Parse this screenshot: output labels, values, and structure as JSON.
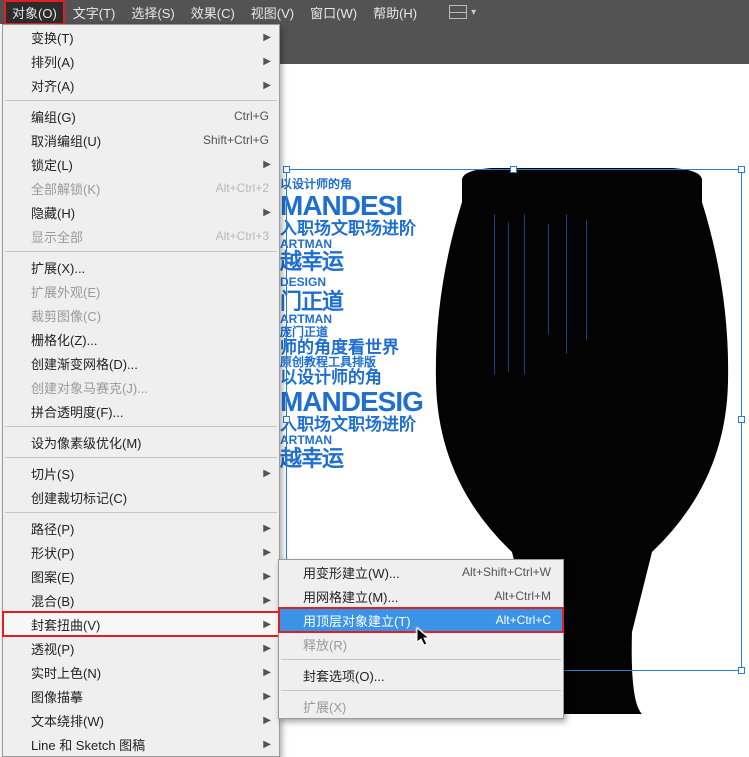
{
  "menubar": {
    "items": [
      {
        "label": "对象(O)",
        "active": true
      },
      {
        "label": "文字(T)"
      },
      {
        "label": "选择(S)"
      },
      {
        "label": "效果(C)"
      },
      {
        "label": "视图(V)"
      },
      {
        "label": "窗口(W)"
      },
      {
        "label": "帮助(H)"
      }
    ]
  },
  "menu": {
    "items": [
      {
        "label": "变换(T)",
        "arrow": true
      },
      {
        "label": "排列(A)",
        "arrow": true
      },
      {
        "label": "对齐(A)",
        "arrow": true
      },
      {
        "sep": true
      },
      {
        "label": "编组(G)",
        "sc": "Ctrl+G"
      },
      {
        "label": "取消编组(U)",
        "sc": "Shift+Ctrl+G"
      },
      {
        "label": "锁定(L)",
        "arrow": true
      },
      {
        "label": "全部解锁(K)",
        "sc": "Alt+Ctrl+2",
        "disabled": true
      },
      {
        "label": "隐藏(H)",
        "arrow": true
      },
      {
        "label": "显示全部",
        "sc": "Alt+Ctrl+3",
        "disabled": true
      },
      {
        "sep": true
      },
      {
        "label": "扩展(X)..."
      },
      {
        "label": "扩展外观(E)",
        "disabled": true
      },
      {
        "label": "裁剪图像(C)",
        "disabled": true
      },
      {
        "label": "栅格化(Z)..."
      },
      {
        "label": "创建渐变网格(D)..."
      },
      {
        "label": "创建对象马赛克(J)...",
        "disabled": true
      },
      {
        "label": "拼合透明度(F)..."
      },
      {
        "sep": true
      },
      {
        "label": "设为像素级优化(M)"
      },
      {
        "sep": true
      },
      {
        "label": "切片(S)",
        "arrow": true
      },
      {
        "label": "创建裁切标记(C)"
      },
      {
        "sep": true
      },
      {
        "label": "路径(P)",
        "arrow": true
      },
      {
        "label": "形状(P)",
        "arrow": true
      },
      {
        "label": "图案(E)",
        "arrow": true
      },
      {
        "label": "混合(B)",
        "arrow": true
      },
      {
        "label": "封套扭曲(V)",
        "arrow": true,
        "hl": true
      },
      {
        "label": "透视(P)",
        "arrow": true
      },
      {
        "label": "实时上色(N)",
        "arrow": true
      },
      {
        "label": "图像描摹",
        "arrow": true
      },
      {
        "label": "文本绕排(W)",
        "arrow": true
      },
      {
        "label": "Line 和 Sketch 图稿",
        "arrow": true
      }
    ]
  },
  "submenu": {
    "items": [
      {
        "label": "用变形建立(W)...",
        "sc": "Alt+Shift+Ctrl+W"
      },
      {
        "label": "用网格建立(M)...",
        "sc": "Alt+Ctrl+M"
      },
      {
        "label": "用顶层对象建立(T)",
        "sc": "Alt+Ctrl+C",
        "sel": true
      },
      {
        "label": "释放(R)",
        "disabled": true
      },
      {
        "sep": true
      },
      {
        "label": "封套选项(O)..."
      },
      {
        "sep": true
      },
      {
        "label": "扩展(X)",
        "disabled": true
      }
    ]
  },
  "art": {
    "t1": "以设计师的角",
    "t2": "MANDESI",
    "t3": "入职场文职场进阶",
    "t4": "越幸运",
    "t5": "DESIGN",
    "t6": "门正道",
    "t7": "ARTMAN",
    "t8": "师的角度看世界",
    "t9": "原创教程工具排版",
    "t10": "以设计师的角",
    "t11": "MANDESIG",
    "t12": "入职场文职场进阶",
    "t13": "越幸运",
    "t14": "ARTMAN",
    "t15": "庞门正道"
  }
}
